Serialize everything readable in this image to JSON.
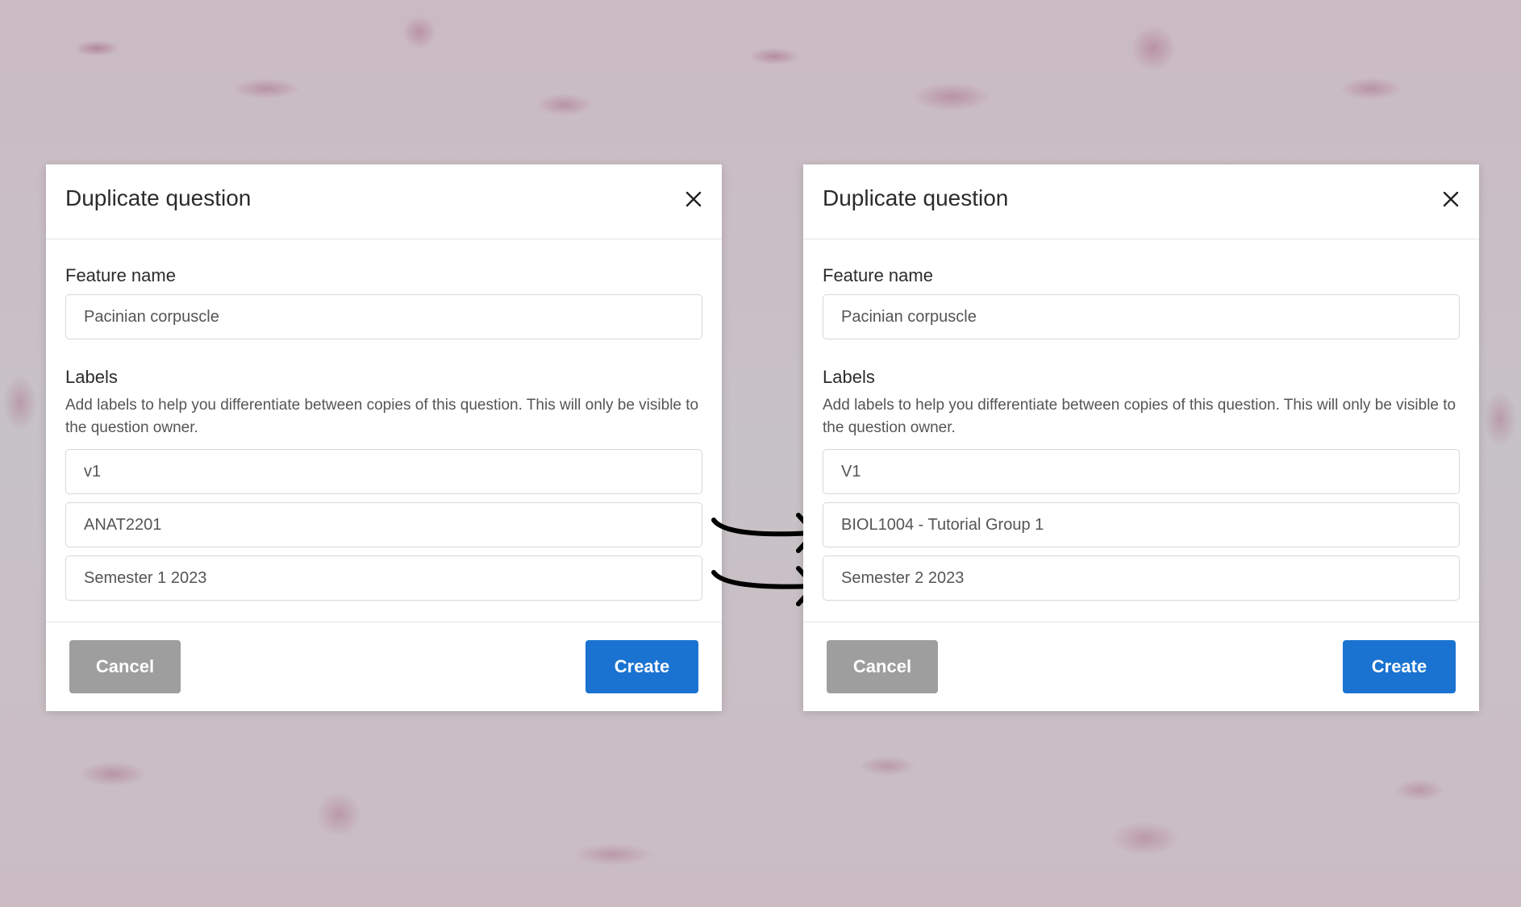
{
  "dialogs": [
    {
      "title": "Duplicate question",
      "feature_name_label": "Feature name",
      "feature_name_value": "Pacinian corpuscle",
      "labels_heading": "Labels",
      "labels_help": "Add labels to help you differentiate between copies of this question. This will only be visible to the question owner.",
      "labels": [
        "v1",
        "ANAT2201",
        "Semester 1 2023"
      ],
      "cancel_label": "Cancel",
      "create_label": "Create"
    },
    {
      "title": "Duplicate question",
      "feature_name_label": "Feature name",
      "feature_name_value": "Pacinian corpuscle",
      "labels_heading": "Labels",
      "labels_help": "Add labels to help you differentiate between copies of this question. This will only be visible to the question owner.",
      "labels": [
        "V1",
        "BIOL1004 - Tutorial Group 1",
        "Semester 2 2023"
      ],
      "cancel_label": "Cancel",
      "create_label": "Create"
    }
  ],
  "icons": {
    "close": "close-icon",
    "arrow": "curved-arrow-right-icon"
  },
  "colors": {
    "create_button": "#1a73d1",
    "cancel_button": "#9e9e9e",
    "background_tissue": "#c9bcc3"
  }
}
